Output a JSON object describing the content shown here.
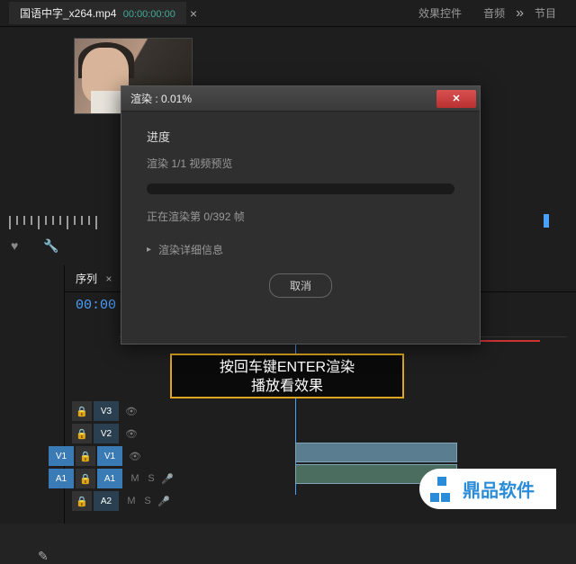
{
  "header": {
    "source_name": "国语中字_x264.mp4",
    "source_ts": "00:00:00:00",
    "tab_effects": "效果控件",
    "tab_audio": "音频",
    "tab_program": "节目"
  },
  "dialog": {
    "title": "渲染 : 0.01%",
    "section": "进度",
    "status": "渲染 1/1 视频预览",
    "frame_status": "正在渲染第 0/392 帧",
    "detail": "渲染详细信息",
    "cancel": "取消"
  },
  "sequence": {
    "tab": "序列",
    "timecode": "00:00"
  },
  "tracks": {
    "v3": "V3",
    "v2": "V2",
    "v1": "V1",
    "a1": "A1",
    "a2": "A2"
  },
  "caption": {
    "line1": "按回车键ENTER渲染",
    "line2": "播放看效果"
  },
  "watermark": {
    "text": "鼎品软件"
  },
  "icons": {
    "close": "×",
    "expand": "»",
    "heart": "♥",
    "wrench": "🔧",
    "lock": "🔒",
    "eye": "👁",
    "mic": "🎤",
    "mute": "M",
    "solo": "S",
    "pen": "✎",
    "razor": "✂",
    "arrow_right": "▸"
  }
}
